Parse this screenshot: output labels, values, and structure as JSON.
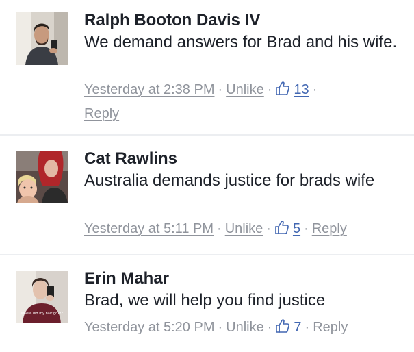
{
  "comments": [
    {
      "author": "Ralph Booton Davis IV",
      "text": "We demand answers for Brad and his wife.",
      "timestamp": "Yesterday at 2:38 PM",
      "unlike_label": "Unlike",
      "like_count": "13",
      "reply_label": "Reply"
    },
    {
      "author": "Cat Rawlins",
      "text": "Australia demands justice for brads wife",
      "timestamp": "Yesterday at 5:11 PM",
      "unlike_label": "Unlike",
      "like_count": "5",
      "reply_label": "Reply"
    },
    {
      "author": "Erin Mahar",
      "text": "Brad, we will help you find justice",
      "timestamp": "Yesterday at 5:20 PM",
      "unlike_label": "Unlike",
      "like_count": "7",
      "reply_label": "Reply",
      "avatar_caption": "where did my hair go???"
    }
  ],
  "separator": "·",
  "colors": {
    "text": "#1d2129",
    "meta": "#90949c",
    "like_blue": "#4267b2",
    "divider": "#eceef1"
  },
  "icons": {
    "like": "thumbs-up-icon"
  }
}
